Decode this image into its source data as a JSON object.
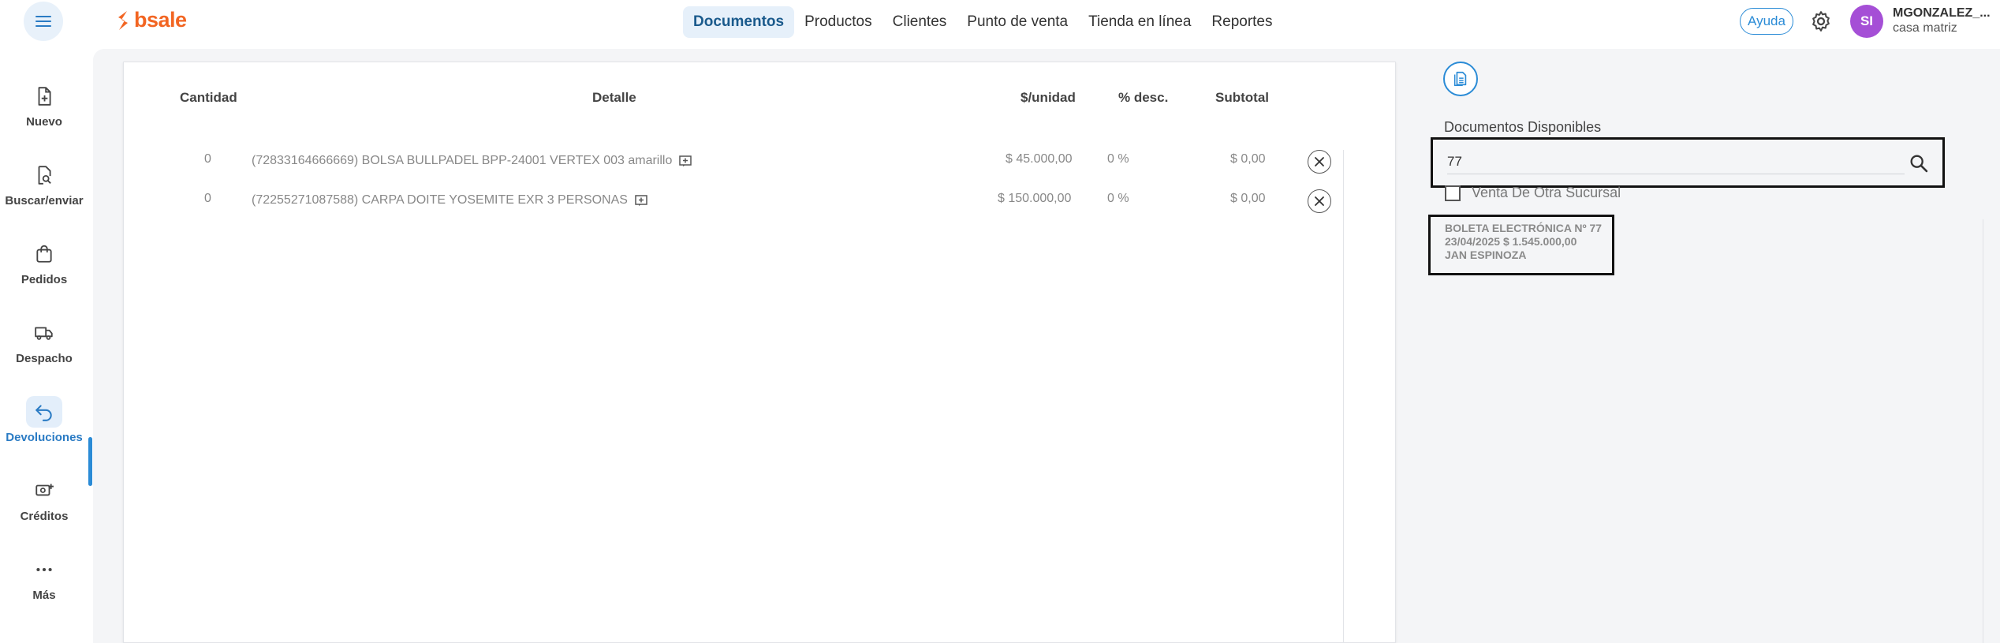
{
  "header": {
    "logo_text": "bsale",
    "nav": [
      {
        "label": "Documentos",
        "active": true
      },
      {
        "label": "Productos",
        "active": false
      },
      {
        "label": "Clientes",
        "active": false
      },
      {
        "label": "Punto de venta",
        "active": false
      },
      {
        "label": "Tienda en línea",
        "active": false
      },
      {
        "label": "Reportes",
        "active": false
      }
    ],
    "help_label": "Ayuda",
    "avatar_initials": "SI",
    "user_name": "MGONZALEZ_...",
    "user_branch": "casa matriz"
  },
  "sidebar": {
    "items": [
      {
        "label": "Nuevo",
        "icon": "new-document-icon"
      },
      {
        "label": "Buscar/enviar",
        "icon": "search-document-icon"
      },
      {
        "label": "Pedidos",
        "icon": "shopping-bag-icon"
      },
      {
        "label": "Despacho",
        "icon": "truck-icon"
      },
      {
        "label": "Devoluciones",
        "icon": "return-arrow-icon",
        "active": true
      },
      {
        "label": "Créditos",
        "icon": "credit-icon"
      },
      {
        "label": "Más",
        "icon": "more-icon"
      }
    ]
  },
  "table": {
    "headers": {
      "quantity": "Cantidad",
      "detail": "Detalle",
      "unit_price": "$/unidad",
      "discount": "% desc.",
      "subtotal": "Subtotal"
    },
    "rows": [
      {
        "quantity": "0",
        "detail": "(72833164666669) BOLSA BULLPADEL BPP-24001 VERTEX 003 amarillo",
        "unit_price": "$ 45.000,00",
        "discount": "0 %",
        "subtotal": "$ 0,00"
      },
      {
        "quantity": "0",
        "detail": "(72255271087588) CARPA DOITE YOSEMITE EXR 3 PERSONAS",
        "unit_price": "$ 150.000,00",
        "discount": "0 %",
        "subtotal": "$ 0,00"
      }
    ]
  },
  "right_panel": {
    "available_label": "Documentos Disponibles",
    "search_value": "77",
    "search_placeholder": "",
    "other_branch_label": "Venta De Otra Sucursal",
    "other_branch_checked": false,
    "result": {
      "line1": "BOLETA ELECTRÓNICA Nº 77",
      "line2": "23/04/2025 $ 1.545.000,00",
      "line3": "JAN ESPINOZA"
    }
  },
  "colors": {
    "brand": "#f26522",
    "accent": "#2a8bd6",
    "avatar": "#a54fd6",
    "nav_active_bg": "#e6f0fa"
  }
}
